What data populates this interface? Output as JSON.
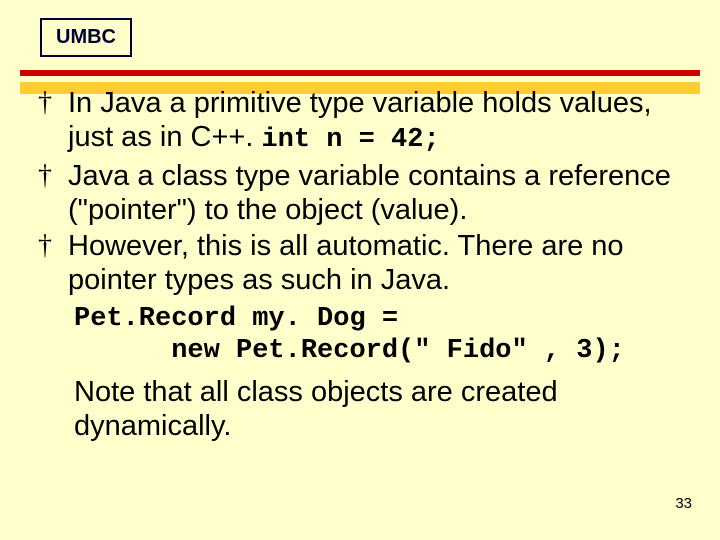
{
  "logo": "UMBC",
  "bullets": [
    {
      "text_a": "In Java a primitive type variable holds values, just as in C++.   ",
      "code": "int n = 42;"
    },
    {
      "text_a": "Java a class type variable contains a reference (\"pointer\") to the object (value)."
    },
    {
      "text_a": "However, this is all automatic. There are no pointer types as such in Java."
    }
  ],
  "code_block": "Pet.Record my. Dog =\n      new Pet.Record(\" Fido\" , 3);",
  "note": "Note that all class objects are created dynamically.",
  "page_number": "33"
}
